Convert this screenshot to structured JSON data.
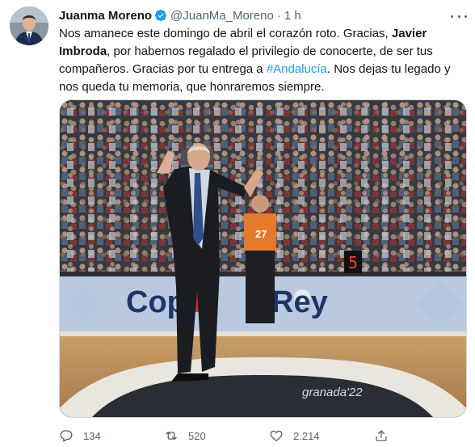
{
  "tweet": {
    "author_name": "Juanma Moreno",
    "handle": "@JuanMa_Moreno",
    "separator": "·",
    "time": "1 h",
    "text_parts": {
      "p1": "Nos amanece este domingo de abril el corazón roto. Gracias, ",
      "bold_name": "Javier Imbroda",
      "p2": ", por habernos regalado el privilegio de conocerte, de ser tus compañeros. Gracias por tu entrega a ",
      "hashtag": "#Andalucía",
      "p3": ". Nos dejas tu legado y nos queda tu memoria, que honraremos siempre."
    },
    "media": {
      "court_banner_left": "Cop",
      "court_banner_right": "Rey",
      "shot_clock": "5",
      "jersey_number": "27",
      "floor_text": "granada'22"
    }
  },
  "actions": {
    "reply_count": "134",
    "retweet_count": "520",
    "like_count": "2.214"
  },
  "colors": {
    "accent": "#1d9bf0",
    "text": "#0f1419",
    "secondary": "#536471"
  },
  "icons": {
    "verified": "verified-badge-icon",
    "more": "more-options-icon",
    "reply": "reply-icon",
    "retweet": "retweet-icon",
    "like": "heart-icon",
    "share": "share-icon"
  }
}
